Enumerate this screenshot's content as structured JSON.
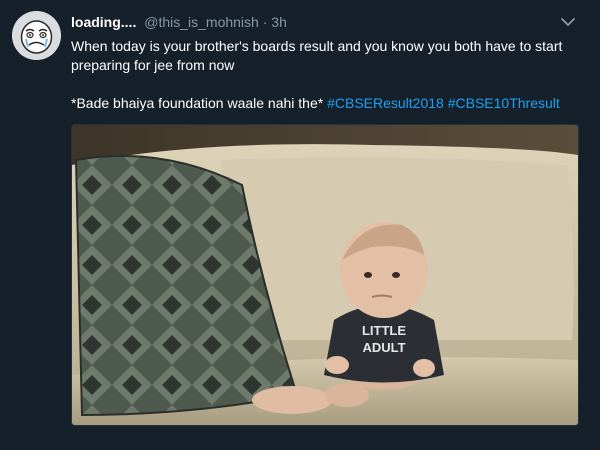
{
  "tweet": {
    "display_name": "loading....",
    "handle": "@this_is_mohnish",
    "separator": "·",
    "time": "3h",
    "text_line1": "When today is your brother's boards result and you know you both have to start preparing for jee from now",
    "text_line2_prefix": "*Bade bhaiya foundation waale nahi the*",
    "hashtags": [
      "#CBSEResult2018",
      "#CBSE10Thresult"
    ],
    "media_alt": "baby sitting on a sofa",
    "shirt_text": [
      "LITTLE",
      "ADULT"
    ]
  },
  "icons": {
    "avatar": "rage-comic-face-icon",
    "menu": "chevron-down-icon"
  },
  "colors": {
    "background": "#15202b",
    "text": "#ffffff",
    "muted": "#8899a6",
    "accent": "#1da1f2"
  }
}
